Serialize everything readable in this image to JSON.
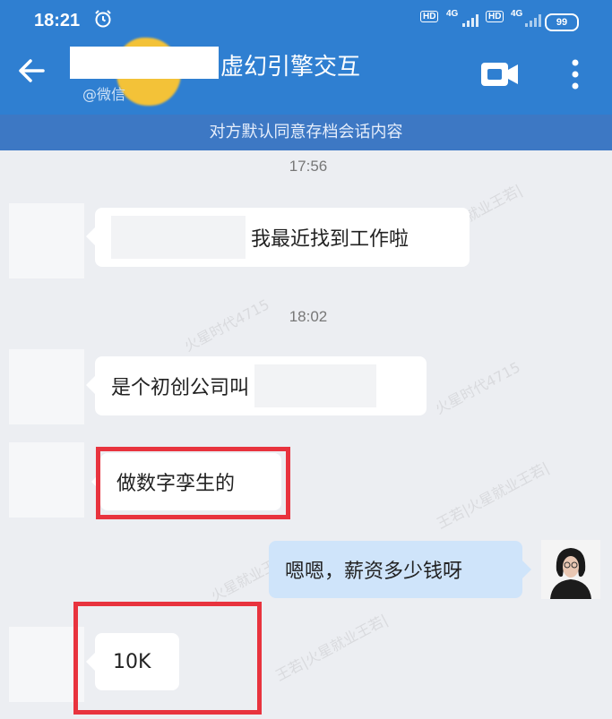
{
  "status_bar": {
    "time": "18:21",
    "signal1": "4G",
    "signal2": "4G",
    "hd1": "HD",
    "hd2": "HD",
    "battery": "99"
  },
  "header": {
    "title": "虚幻引擎交互",
    "subtitle": "@微信",
    "back_icon": "back-arrow-icon",
    "video_icon": "video-call-icon",
    "more_icon": "more-vertical-icon"
  },
  "notice": "对方默认同意存档会话内容",
  "messages": [
    {
      "time": "17:56",
      "side": "left",
      "text": "我最近找到工作啦"
    },
    {
      "time": "18:02",
      "side": "left",
      "text": "是个初创公司叫"
    },
    {
      "side": "left",
      "text": "做数字孪生的"
    },
    {
      "side": "right",
      "text": "嗯嗯，薪资多少钱呀"
    },
    {
      "side": "left",
      "text": "10K"
    }
  ],
  "colors": {
    "header_blue": "#2f7fd1",
    "notice_blue": "#3d78c4",
    "highlight_red": "#e8333e",
    "my_bubble": "#cfe4fa"
  }
}
